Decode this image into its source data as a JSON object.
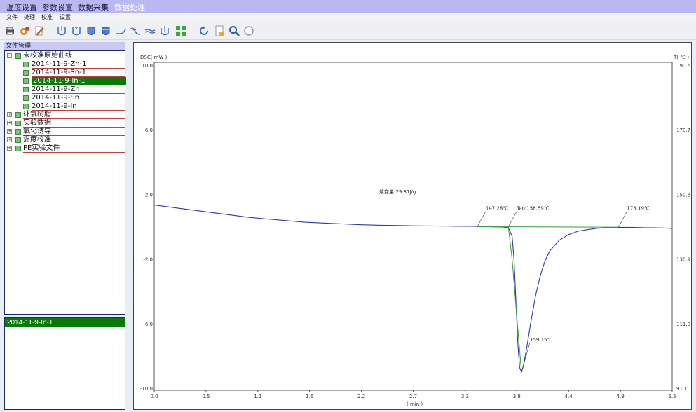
{
  "top_tabs": [
    "温度设置",
    "参数设置",
    "数据采集",
    "数据处理"
  ],
  "active_tab": "数据处理",
  "menu": [
    "文件",
    "处理",
    "校准",
    "设置"
  ],
  "toolbar": [
    "print-icon",
    "settings-gear-icon",
    "edit-pencil-icon",
    "tangent-cup-icon",
    "peak-cup-icon",
    "fill-cup-icon",
    "fill-cup-2-icon",
    "baseline-icon",
    "step-icon",
    "smooth-icon",
    "integrate-icon",
    "grid-icon",
    "undo-icon",
    "export-icon",
    "zoom-icon",
    "reset-icon"
  ],
  "file_panel": {
    "title": "文件管理",
    "tree": [
      {
        "label": "未校准原始曲线",
        "expanded": true,
        "children": [
          "2014-11-9-Zn-1",
          "2014-11-9-Sn-1",
          "2014-11-9-In-1",
          "2014-11-9-Zn",
          "2014-11-9-Sn",
          "2014-11-9-In"
        ]
      },
      {
        "label": "环氧树脂",
        "expanded": false
      },
      {
        "label": "实验数据",
        "expanded": false
      },
      {
        "label": "氧化诱导",
        "expanded": false
      },
      {
        "label": "温度校准",
        "expanded": false
      },
      {
        "label": "PE实验文件",
        "expanded": false
      }
    ],
    "selected": "2014-11-9-In-1"
  },
  "detail_panel": {
    "header": "2014-11-9-In-1"
  },
  "chart_data": {
    "type": "line",
    "ylabel": "DSC( mW )",
    "y2label": "T( ℃ )",
    "xlabel": "( min )",
    "xlim": [
      0.0,
      5.5
    ],
    "ylim": [
      -10.0,
      10.0
    ],
    "y2lim": [
      91.1,
      190.6
    ],
    "x_ticks": [
      "0.0",
      "0.5",
      "1.1",
      "1.6",
      "2.2",
      "2.7",
      "3.3",
      "3.8",
      "4.4",
      "4.9",
      "5.5"
    ],
    "y_ticks": [
      "10.0",
      "6.0",
      "2.0",
      "-2.0",
      "-6.0",
      "-10.0"
    ],
    "y2_ticks": [
      "190.6",
      "170.7",
      "150.8",
      "130.9",
      "111.0",
      "91.1"
    ],
    "grid": false,
    "series": [
      {
        "color": "#2a3aa8",
        "x": [
          0.0,
          0.2,
          0.4,
          0.6,
          0.8,
          1.0,
          1.2,
          1.4,
          1.6,
          1.8,
          2.0,
          2.2,
          2.4,
          2.6,
          2.8,
          3.0,
          3.2,
          3.4,
          3.6,
          3.7,
          3.76,
          3.8,
          3.82,
          3.84,
          3.86,
          3.88,
          3.9,
          3.92,
          3.95,
          4.0,
          4.05,
          4.1,
          4.15,
          4.2,
          4.3,
          4.4,
          4.5,
          4.6,
          4.7,
          4.8,
          4.9,
          5.0,
          5.1,
          5.2,
          5.3,
          5.4,
          5.5
        ],
        "y": [
          1.3,
          1.15,
          1.0,
          0.85,
          0.7,
          0.55,
          0.45,
          0.35,
          0.25,
          0.2,
          0.15,
          0.1,
          0.07,
          0.05,
          0.03,
          0.02,
          0.01,
          0.0,
          -0.03,
          -0.04,
          -0.08,
          -0.6,
          -2.0,
          -4.5,
          -7.0,
          -8.6,
          -8.9,
          -8.5,
          -7.6,
          -5.8,
          -4.2,
          -3.0,
          -2.1,
          -1.5,
          -0.85,
          -0.5,
          -0.3,
          -0.2,
          -0.12,
          -0.08,
          -0.06,
          -0.06,
          -0.07,
          -0.08,
          -0.09,
          -0.1,
          -0.12
        ]
      },
      {
        "color": "#33a033",
        "x": [
          3.43,
          4.93
        ],
        "y": [
          -0.02,
          -0.05
        ]
      },
      {
        "color": "#33a033",
        "x": [
          3.76,
          3.8,
          3.85,
          3.9
        ],
        "y": [
          0.0,
          -2.0,
          -5.5,
          -8.9
        ]
      }
    ],
    "annotations": [
      {
        "text": "焓变量:29.31J/g",
        "x": 2.3,
        "y": 2.0
      },
      {
        "text": "147.28℃",
        "x": 3.43,
        "y": 1.0
      },
      {
        "text": "Teo:156.59℃",
        "x": 3.76,
        "y": 1.0
      },
      {
        "text": "178.19℃",
        "x": 4.93,
        "y": 1.0
      },
      {
        "text": "159.15℃",
        "x": 3.9,
        "y": -7.0
      }
    ]
  }
}
